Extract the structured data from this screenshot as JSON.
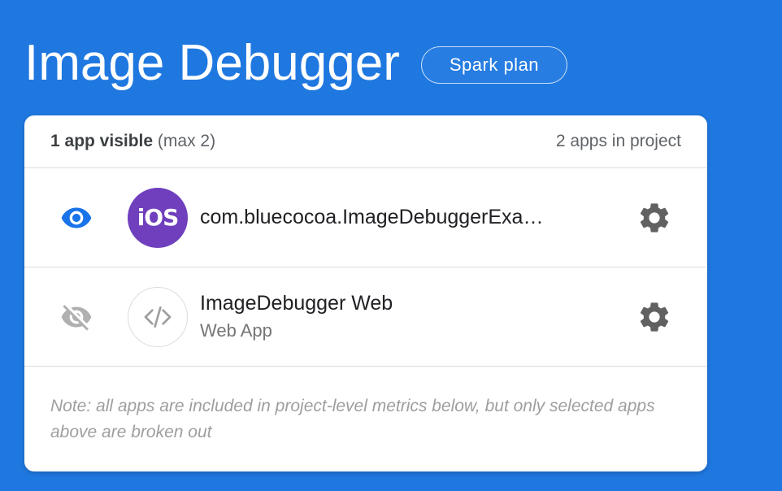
{
  "header": {
    "title": "Image Debugger",
    "plan_badge": "Spark plan"
  },
  "card": {
    "visible_count": "1 app visible",
    "visible_max": "(max 2)",
    "apps_in_project": "2 apps in project",
    "apps": [
      {
        "name": "com.bluecocoa.ImageDebuggerExa…",
        "subtitle": "",
        "platform_label": "iOS",
        "platform_icon": "ios-icon",
        "visible": true,
        "visibility_icon": "eye-icon",
        "settings_icon": "gear-icon"
      },
      {
        "name": "ImageDebugger Web",
        "subtitle": "Web App",
        "platform_label": "",
        "platform_icon": "code-brackets-icon",
        "visible": false,
        "visibility_icon": "eye-off-icon",
        "settings_icon": "gear-icon"
      }
    ],
    "note": "Note: all apps are included in project-level metrics below, but only selected apps above are broken out"
  },
  "colors": {
    "background": "#1f78e0",
    "badge_background": "#1f78e0",
    "ios_icon": "#6f3fbd",
    "eye_active": "#1a73e8",
    "eye_inactive": "#b0b0b0",
    "gear": "#616161"
  }
}
